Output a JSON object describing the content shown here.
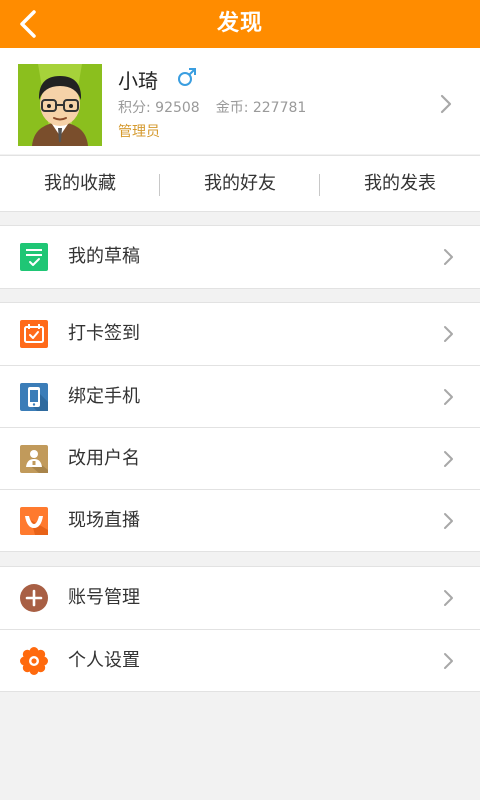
{
  "header": {
    "title": "发现"
  },
  "profile": {
    "name": "小琦",
    "gender_icon": "male-symbol",
    "points_label": "积分: 92508",
    "coins_label": "金币: 227781",
    "role": "管理员"
  },
  "tabs": [
    {
      "label": "我的收藏"
    },
    {
      "label": "我的好友"
    },
    {
      "label": "我的发表"
    }
  ],
  "groups": [
    {
      "items": [
        {
          "label": "我的草稿",
          "icon": "draft-icon"
        }
      ]
    },
    {
      "items": [
        {
          "label": "打卡签到",
          "icon": "calendar-checkin-icon"
        },
        {
          "label": "绑定手机",
          "icon": "phone-icon"
        },
        {
          "label": "改用户名",
          "icon": "user-card-icon"
        },
        {
          "label": "现场直播",
          "icon": "live-icon"
        }
      ]
    },
    {
      "items": [
        {
          "label": "账号管理",
          "icon": "add-circle-icon"
        },
        {
          "label": "个人设置",
          "icon": "gear-icon"
        }
      ]
    }
  ],
  "colors": {
    "accent": "#ff8c00",
    "role": "#d59a2f",
    "draft": "#1fc675",
    "checkin": "#ff6a1a",
    "phone": "#3b7db8",
    "username": "#c19a5b",
    "live": "#ff7a2e",
    "account": "#a85f44",
    "settings": "#ff6a0e"
  }
}
